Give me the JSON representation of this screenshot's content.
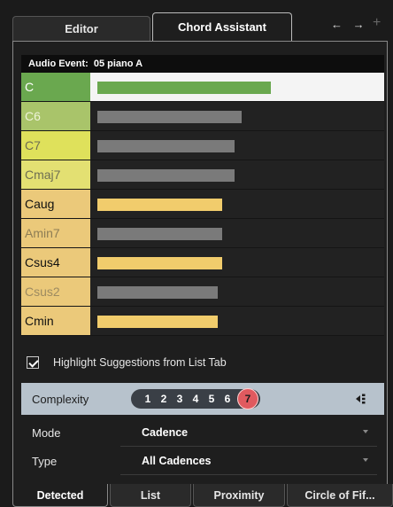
{
  "tabs": {
    "editor": "Editor",
    "chord_assistant": "Chord Assistant",
    "nav_arrows": "← →",
    "add": "+"
  },
  "audio_event": {
    "label": "Audio Event:",
    "value": "05 piano A"
  },
  "chords": [
    {
      "name": "C",
      "strength": 0.72,
      "name_bg": "#6aa84f",
      "name_color": "#ffffff",
      "bar_color": "#6aa84f",
      "row_bg": "#f4f4f4"
    },
    {
      "name": "C6",
      "strength": 0.6,
      "name_bg": "#a9c46a",
      "name_color": "#eef3d8",
      "bar_color": "#7a7a7a",
      "row_bg": "#222222"
    },
    {
      "name": "C7",
      "strength": 0.57,
      "name_bg": "#dfe15b",
      "name_color": "#6e6e52",
      "bar_color": "#7a7a7a",
      "row_bg": "#222222"
    },
    {
      "name": "Cmaj7",
      "strength": 0.57,
      "name_bg": "#e3e072",
      "name_color": "#6e6e52",
      "bar_color": "#7a7a7a",
      "row_bg": "#222222"
    },
    {
      "name": "Caug",
      "strength": 0.52,
      "name_bg": "#ebc97a",
      "name_color": "#111111",
      "bar_color": "#f1cc6c",
      "row_bg": "#222222"
    },
    {
      "name": "Amin7",
      "strength": 0.52,
      "name_bg": "#ebc97a",
      "name_color": "#8d7d55",
      "bar_color": "#7a7a7a",
      "row_bg": "#222222"
    },
    {
      "name": "Csus4",
      "strength": 0.52,
      "name_bg": "#ebc97a",
      "name_color": "#111111",
      "bar_color": "#f1cc6c",
      "row_bg": "#222222"
    },
    {
      "name": "Csus2",
      "strength": 0.5,
      "name_bg": "#ebc97a",
      "name_color": "#9d8b61",
      "bar_color": "#7a7a7a",
      "row_bg": "#222222"
    },
    {
      "name": "Cmin",
      "strength": 0.5,
      "name_bg": "#ebc97a",
      "name_color": "#111111",
      "bar_color": "#f1cc6c",
      "row_bg": "#222222"
    }
  ],
  "highlight_checkbox": {
    "label": "Highlight Suggestions from List Tab",
    "checked": true
  },
  "complexity": {
    "label": "Complexity",
    "levels": [
      "1",
      "2",
      "3",
      "4",
      "5",
      "6",
      "7"
    ],
    "selected": "7"
  },
  "mode": {
    "label": "Mode",
    "value": "Cadence"
  },
  "type": {
    "label": "Type",
    "value": "All Cadences"
  },
  "bottom_tabs": {
    "detected": "Detected",
    "list": "List",
    "proximity": "Proximity",
    "circle": "Circle of Fif..."
  },
  "colors": {
    "accent_selected": "#e05a5f",
    "complexity_bg": "#b7c2cc"
  }
}
